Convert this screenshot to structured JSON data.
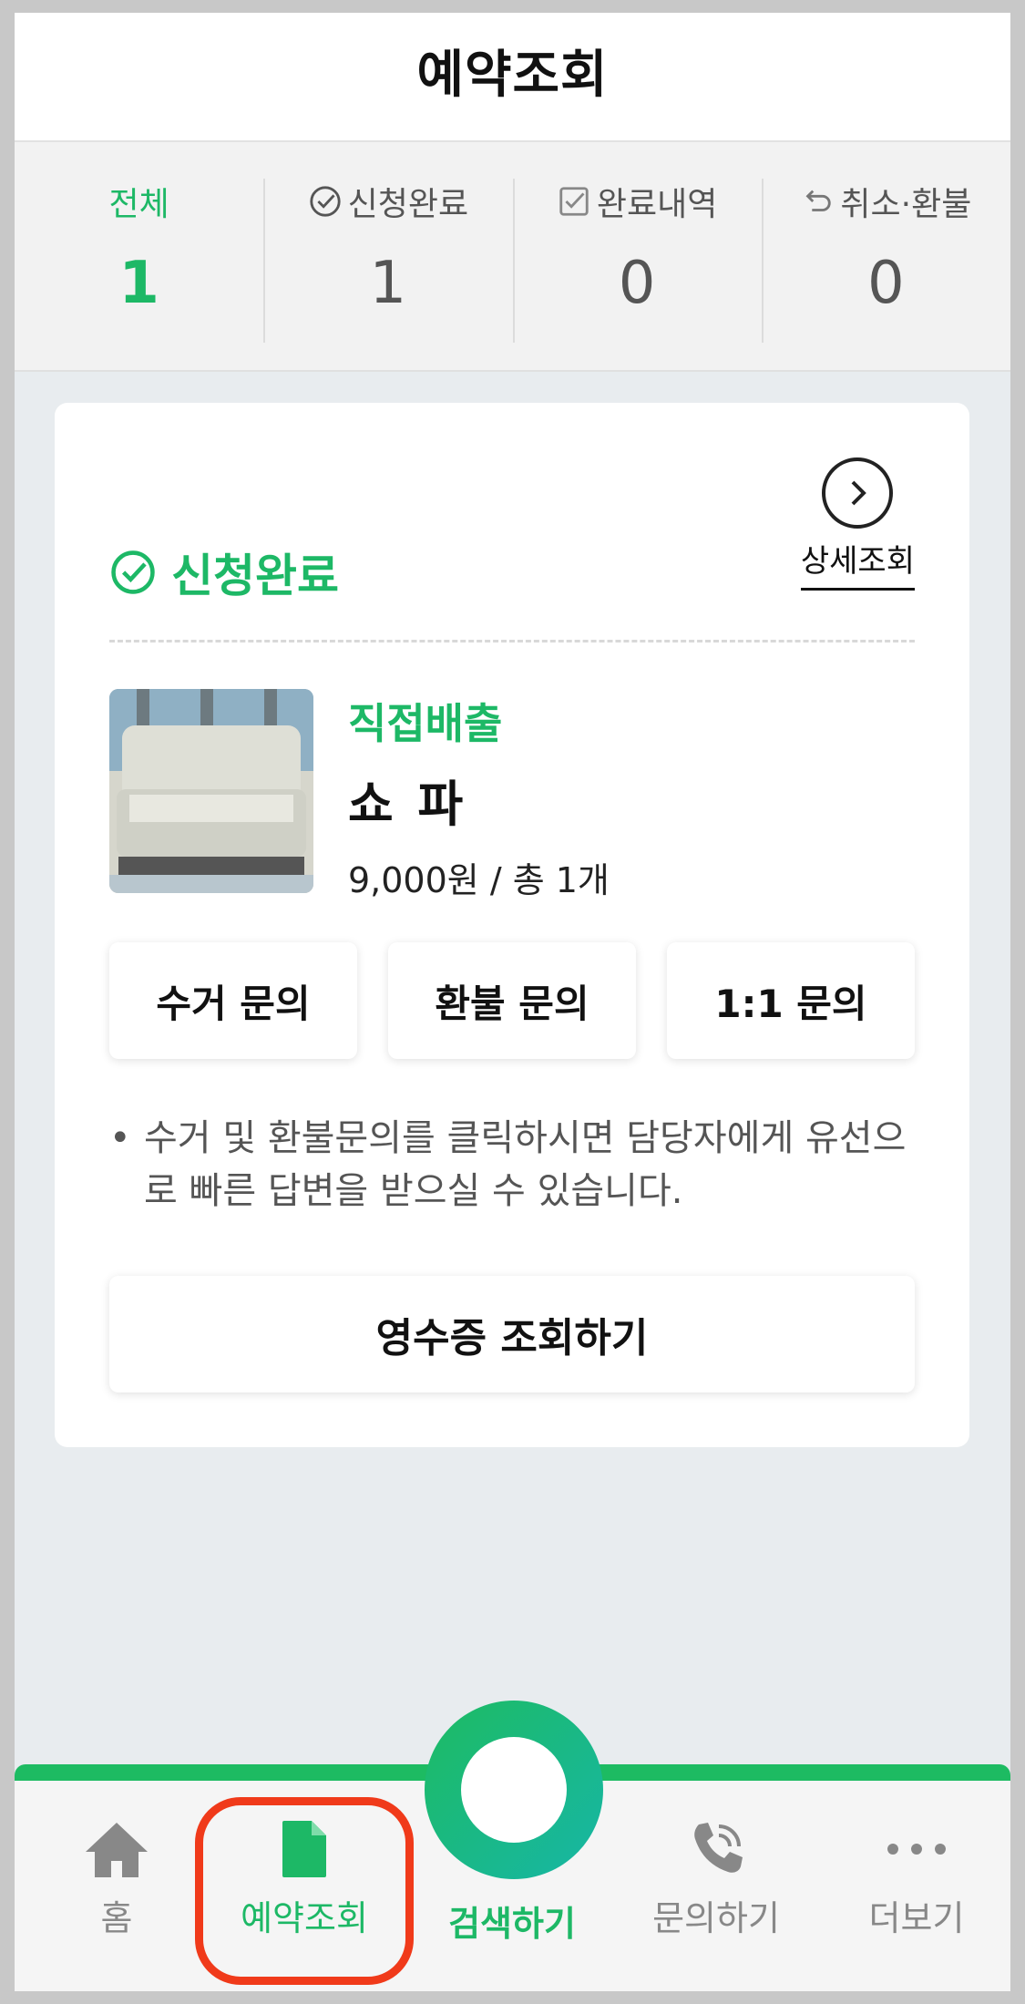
{
  "header": {
    "title": "예약조회"
  },
  "stats": [
    {
      "label": "전체",
      "value": "1",
      "icon": ""
    },
    {
      "label": "신청완료",
      "value": "1",
      "icon": "check-circle-icon"
    },
    {
      "label": "완료내역",
      "value": "0",
      "icon": "checkbox-icon"
    },
    {
      "label": "취소·환불",
      "value": "0",
      "icon": "undo-icon"
    }
  ],
  "colors": {
    "accent": "#1db866",
    "highlight": "#f03a1a"
  },
  "card": {
    "status": "신청완료",
    "detail_label": "상세조회",
    "product": {
      "type": "직접배출",
      "name": "쇼 파",
      "price": "9,000원 / 총 1개"
    },
    "buttons": [
      "수거 문의",
      "환불 문의",
      "1:1 문의"
    ],
    "note": "수거 및 환불문의를 클릭하시면 담당자에게 유선으로 빠른 답변을 받으실 수 있습니다.",
    "receipt_label": "영수증 조회하기"
  },
  "nav": {
    "items": [
      {
        "label": "홈",
        "icon": "home-icon"
      },
      {
        "label": "예약조회",
        "icon": "document-icon"
      },
      {
        "label": "검색하기",
        "icon": "search-circle-icon"
      },
      {
        "label": "문의하기",
        "icon": "phone-icon"
      },
      {
        "label": "더보기",
        "icon": "more-icon"
      }
    ]
  }
}
